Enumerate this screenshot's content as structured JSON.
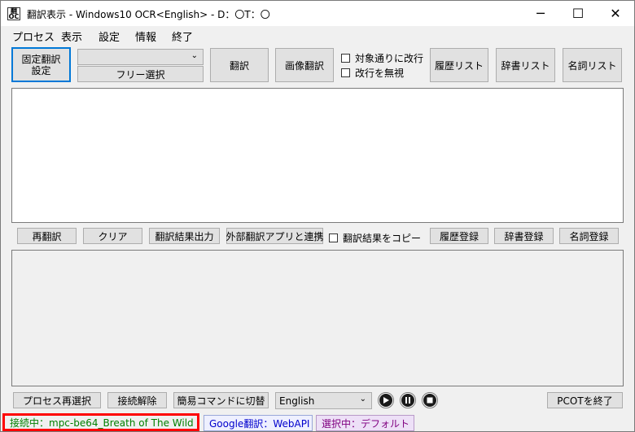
{
  "window": {
    "app_icon_text": "翻\nOC",
    "title": "翻訳表示 - Windows10 OCR<English> - D：〇T：〇",
    "minimize_glyph": "─",
    "maximize_glyph": "☐",
    "close_glyph": "✕"
  },
  "menu": [
    "プロセス",
    "表示",
    "設定",
    "情報",
    "終了"
  ],
  "top_toolbar": {
    "fixed_translation_label_1": "固定翻訳",
    "fixed_translation_label_2": "設定",
    "combo_value": "",
    "free_select_label": "フリー選択",
    "translate_label": "翻訳",
    "image_translate_label": "画像翻訳",
    "checkbox_linebreak_label": "対象通りに改行",
    "checkbox_ignore_label": "改行を無視",
    "history_list_label": "履歴リスト",
    "dictionary_list_label": "辞書リスト",
    "noun_list_label": "名詞リスト"
  },
  "middle_toolbar": {
    "retranslate_label": "再翻訳",
    "clear_label": "クリア",
    "export_label": "翻訳結果出力",
    "external_label": "外部翻訳アプリと連携",
    "copy_checkbox_label": "翻訳結果をコピー",
    "history_register_label": "履歴登録",
    "dictionary_register_label": "辞書登録",
    "noun_register_label": "名詞登録"
  },
  "bottom_toolbar": {
    "reselect_process_label": "プロセス再選択",
    "disconnect_label": "接続解除",
    "simple_command_label": "簡易コマンドに切替",
    "language_value": "English",
    "exit_label": "PCOTを終了"
  },
  "status_bar": {
    "connection": "接続中：mpc-be64_Breath of The Wild",
    "translator": "Google翻訳：WebAPI",
    "selection": "選択中：デフォルト"
  },
  "colors": {
    "connection_text": "#008000",
    "translator_text": "#0000cc",
    "selection_text": "#800080",
    "highlight_border": "#ff0000",
    "focus_border": "#0078d7"
  }
}
